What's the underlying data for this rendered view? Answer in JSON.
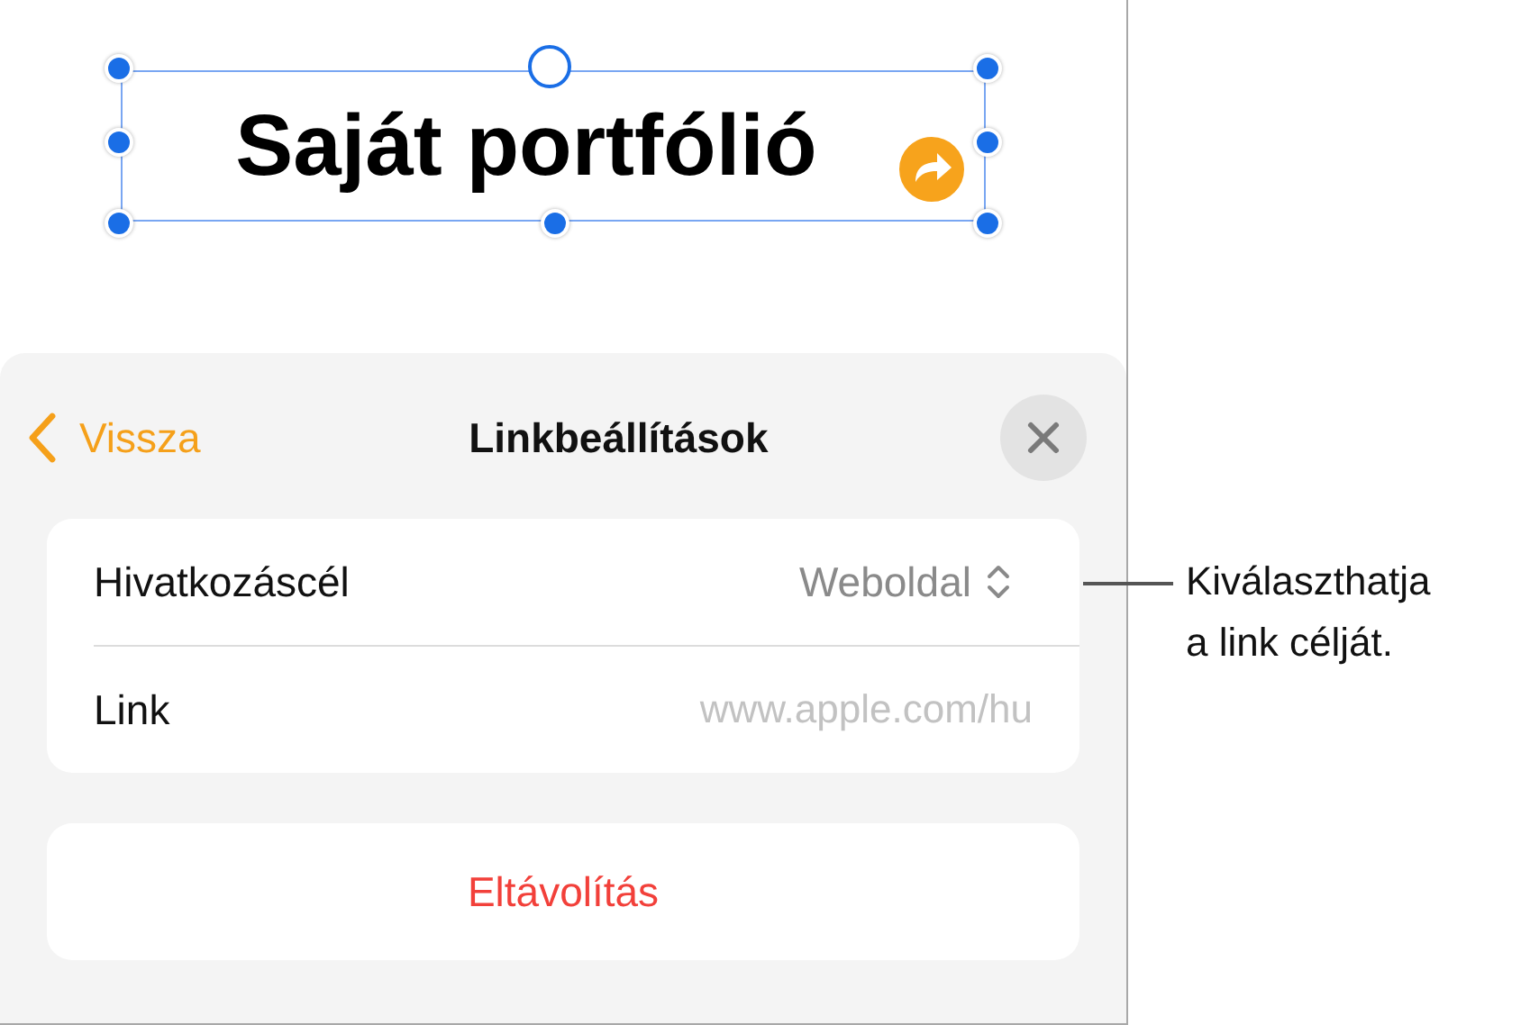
{
  "canvas": {
    "text_box": {
      "text": "Saját portfólió",
      "selected": true,
      "has_link": true
    }
  },
  "panel": {
    "back_label": "Vissza",
    "title": "Linkbeállítások",
    "rows": [
      {
        "kind": "picker",
        "label": "Hivatkozáscél",
        "value": "Weboldal"
      },
      {
        "kind": "field",
        "label": "Link",
        "placeholder": "www.apple.com/hu"
      }
    ],
    "remove_button": "Eltávolítás"
  },
  "callout": "Kiválaszthatja\na link célját."
}
